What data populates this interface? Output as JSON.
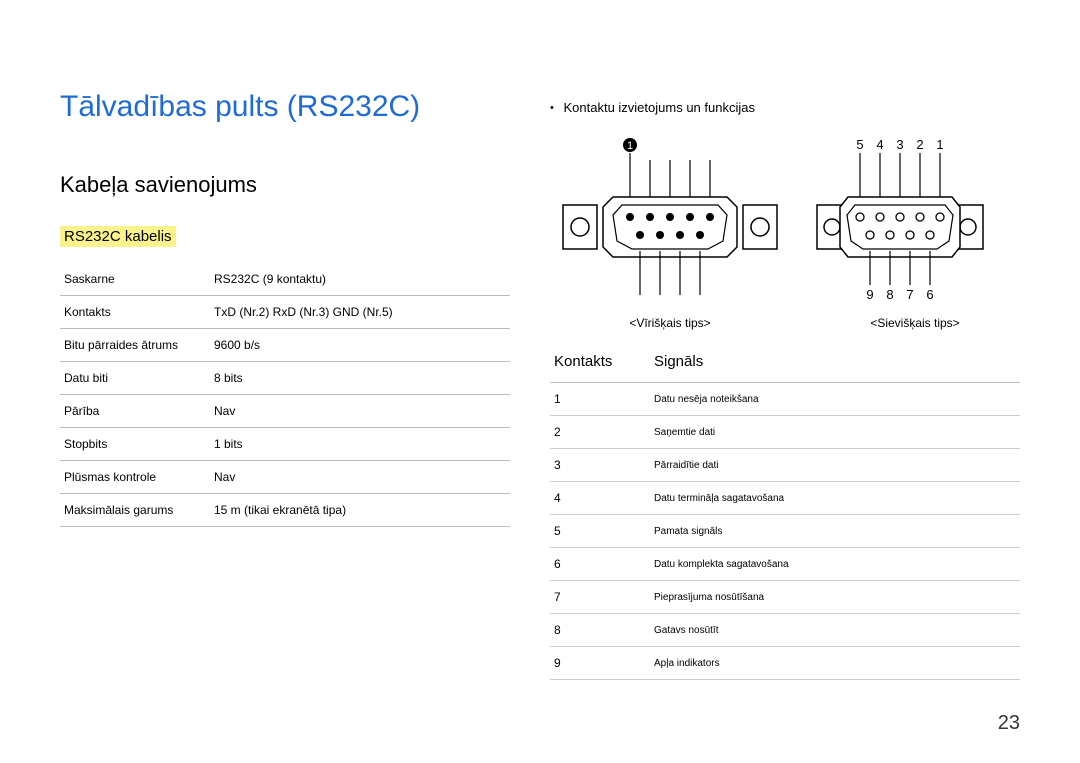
{
  "title": "Tālvadības pults (RS232C)",
  "section_h2": "Kabeļa savienojums",
  "section_h3": "RS232C kabelis",
  "specs": [
    {
      "k": "Saskarne",
      "v": "RS232C (9 kontaktu)"
    },
    {
      "k": "Kontakts",
      "v": "TxD (Nr.2) RxD (Nr.3) GND (Nr.5)"
    },
    {
      "k": "Bitu pārraides ātrums",
      "v": "9600 b/s"
    },
    {
      "k": "Datu biti",
      "v": "8 bits"
    },
    {
      "k": "Pārība",
      "v": "Nav"
    },
    {
      "k": "Stopbits",
      "v": "1 bits"
    },
    {
      "k": "Plūsmas kontrole",
      "v": "Nav"
    },
    {
      "k": "Maksimālais garums",
      "v": "15 m (tikai ekranētā tipa)"
    }
  ],
  "pinout_heading": "Kontaktu izvietojums un funkcijas",
  "pin_marker": "1",
  "male_label": "<Vīrišķais tips>",
  "female_label": "<Sievišķais tips>",
  "female_top_nums": [
    "5",
    "4",
    "3",
    "2",
    "1"
  ],
  "female_bottom_nums": [
    "9",
    "8",
    "7",
    "6"
  ],
  "signal_table": {
    "head_contact": "Kontakts",
    "head_signal": "Signāls",
    "rows": [
      {
        "n": "1",
        "s": "Datu nesēja noteikšana"
      },
      {
        "n": "2",
        "s": "Saņemtie dati"
      },
      {
        "n": "3",
        "s": "Pārraidītie dati"
      },
      {
        "n": "4",
        "s": "Datu termināļa sagatavošana"
      },
      {
        "n": "5",
        "s": "Pamata signāls"
      },
      {
        "n": "6",
        "s": "Datu komplekta sagatavošana"
      },
      {
        "n": "7",
        "s": "Pieprasījuma nosūtīšana"
      },
      {
        "n": "8",
        "s": "Gatavs nosūtīt"
      },
      {
        "n": "9",
        "s": "Apļa indikators"
      }
    ]
  },
  "page_number": "23"
}
